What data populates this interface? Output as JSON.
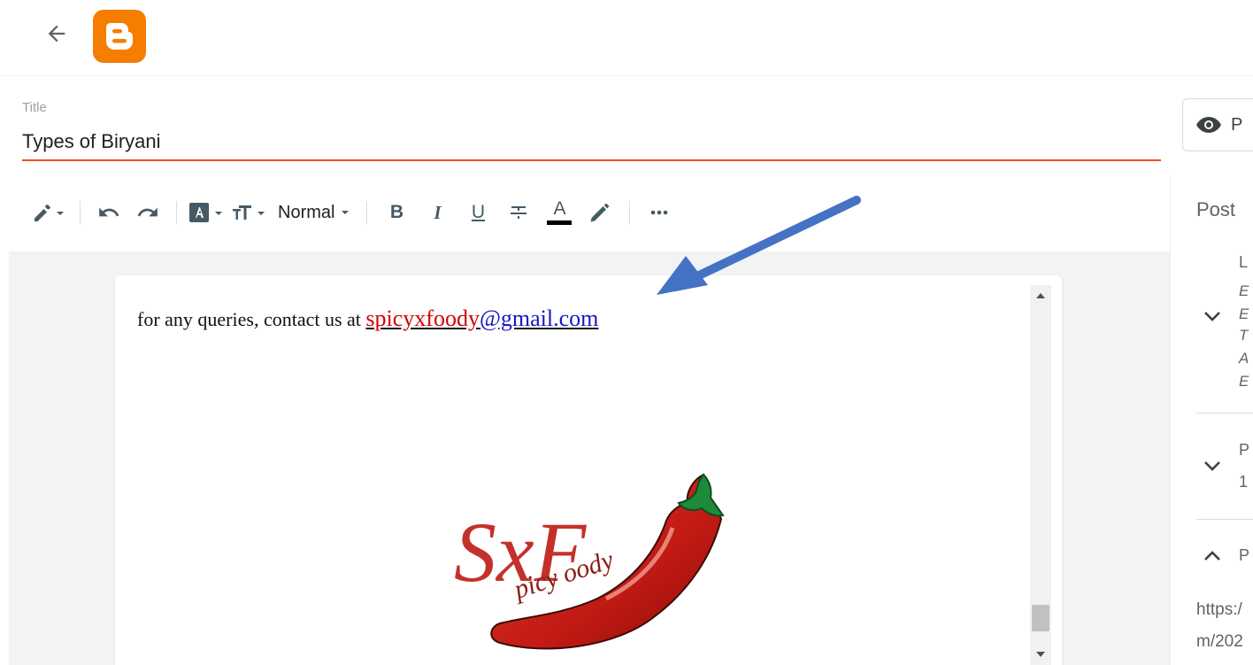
{
  "header": {
    "back_icon": "arrow-left-icon",
    "logo_icon": "blogger-logo-icon",
    "brand_color": "#f57d00"
  },
  "post": {
    "title_label": "Title",
    "title_value": "Types of Biryani"
  },
  "toolbar": {
    "compose_icon": "pencil-icon",
    "undo_icon": "undo-icon",
    "redo_icon": "redo-icon",
    "insert_icon": "font-size-icon",
    "text_size_icon": "text-size-icon",
    "format_label": "Normal",
    "bold_label": "B",
    "italic_label": "I",
    "underline_label": "U",
    "strike_icon": "strikethrough-icon",
    "text_color_label": "A",
    "highlight_icon": "highlighter-icon",
    "more_icon": "more-icon"
  },
  "editor": {
    "line_prefix": "for any queries, contact us at ",
    "email_part1": "spicyxfoody",
    "email_part2": "@gmail.com",
    "logo_letters": "SxF",
    "logo_script": "picy oody",
    "logo_image": "spicyxfoody-chili-logo"
  },
  "side_panel": {
    "preview_label": "P",
    "preview_icon": "eye-icon",
    "heading": "Post",
    "labels_initial": "L",
    "labels_lines": [
      "E",
      "E",
      "T",
      "A",
      "E"
    ],
    "published_initial": "P",
    "published_line": "1",
    "permalink_initial": "P",
    "permalink_line1": "https:/",
    "permalink_line2": "m/202"
  },
  "annotation": {
    "arrow_color": "#4472c4"
  }
}
